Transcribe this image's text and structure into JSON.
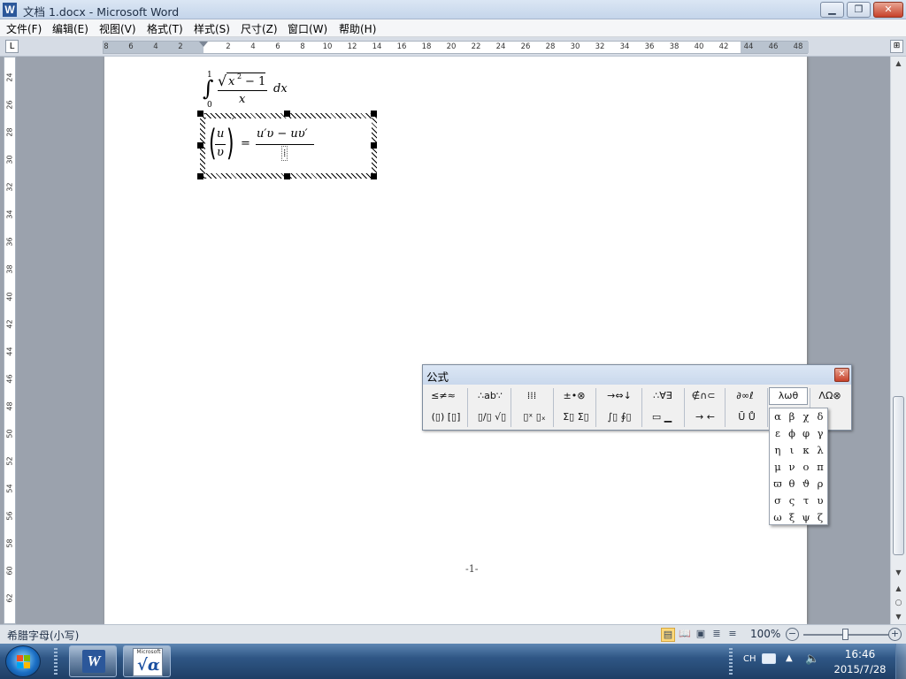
{
  "window": {
    "title": "文档 1.docx - Microsoft Word",
    "app_icon_letter": "W",
    "minimize_glyph": "▁",
    "maximize_glyph": "❐",
    "close_glyph": "✕"
  },
  "menubar": {
    "items": [
      "文件(F)",
      "编辑(E)",
      "视图(V)",
      "格式(T)",
      "样式(S)",
      "尺寸(Z)",
      "窗口(W)",
      "帮助(H)"
    ]
  },
  "ruler": {
    "corner_glyph": "L",
    "right_glyph": "⊞",
    "h_ticks": [
      "8",
      "6",
      "4",
      "2",
      "2",
      "4",
      "6",
      "8",
      "10",
      "12",
      "14",
      "16",
      "18",
      "20",
      "22",
      "24",
      "26",
      "28",
      "30",
      "32",
      "34",
      "36",
      "38",
      "40",
      "42",
      "44",
      "46",
      "48"
    ],
    "v_ticks": [
      "24",
      "26",
      "28",
      "30",
      "32",
      "34",
      "36",
      "38",
      "40",
      "42",
      "44",
      "46",
      "48",
      "50",
      "52",
      "54",
      "56",
      "58",
      "60",
      "62"
    ]
  },
  "document": {
    "eq1": {
      "upper_limit": "1",
      "lower_limit": "0",
      "integral": "∫",
      "radical": "√",
      "radicand_var": "x",
      "radicand_exp": "2",
      "radicand_rest": "− 1",
      "denominator": "x",
      "differential": "dx"
    },
    "eq2": {
      "lhs_num": "u",
      "lhs_den": "υ",
      "prime": "′",
      "equals": "=",
      "rhs_num": "u′υ − uυ′",
      "cursor_slot": "⁞"
    },
    "page_number": "-1-"
  },
  "palette": {
    "title": "公式",
    "close_glyph": "✕",
    "row1": [
      "≤≠≈",
      "∴ab∵",
      "⁞⁞⁞",
      "±•⊗",
      "→⇔↓",
      "∴∀∃",
      "∉∩⊂",
      "∂∞ℓ",
      "λωθ",
      "ΛΩ⊗"
    ],
    "row2": [
      "(▯) [▯]",
      "▯/▯ √▯",
      "▯ˣ ▯ₓ",
      "Σ▯ Σ▯",
      "∫▯ ∮▯",
      "▭ ▁",
      "→ ←",
      "Ū Ů"
    ]
  },
  "greek_dropdown": {
    "rows": [
      [
        "α",
        "β",
        "χ",
        "δ"
      ],
      [
        "ε",
        "ϕ",
        "φ",
        "γ"
      ],
      [
        "η",
        "ι",
        "κ",
        "λ"
      ],
      [
        "μ",
        "ν",
        "ο",
        "π"
      ],
      [
        "ϖ",
        "θ",
        "ϑ",
        "ρ"
      ],
      [
        "σ",
        "ς",
        "τ",
        "υ"
      ],
      [
        "ω",
        "ξ",
        "ψ",
        "ζ"
      ]
    ]
  },
  "statusbar": {
    "text": "希腊字母(小写)",
    "zoom": "100%",
    "zoom_out_glyph": "−",
    "zoom_in_glyph": "+",
    "zoom_level_percent": 100,
    "view_glyphs": [
      "▤",
      "📖",
      "▣",
      "≣",
      "≡"
    ]
  },
  "scrollbar": {
    "up": "▲",
    "down": "▼",
    "prev": "▲",
    "browse": "○",
    "next": "▼"
  },
  "taskbar": {
    "word_letter": "W",
    "eq_brand": "Microsoft",
    "eq_symbol": "√α",
    "tray_lang": "CH",
    "tray_arrow": "▲",
    "tray_volume": "🔈",
    "time": "16:46",
    "date": "2015/7/28"
  },
  "colors": {
    "word_blue": "#2b579a",
    "selection_hatch": "#000000",
    "taskbar": "#2f5685"
  }
}
